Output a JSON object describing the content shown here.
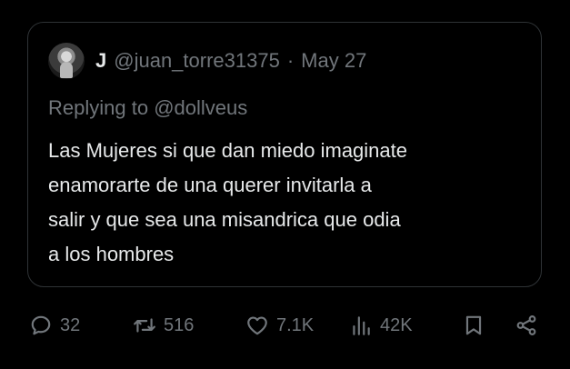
{
  "tweet": {
    "display_name": "J",
    "handle": "@juan_torre31375",
    "separator": "·",
    "date": "May 27",
    "replying_prefix": "Replying to",
    "replying_to": "@dollveus",
    "text_lines": [
      "Las Mujeres si que dan miedo imaginate",
      "enamorarte de una querer invitarla a",
      "salir y que sea una misandrica que odia",
      "a los hombres"
    ]
  },
  "actions": {
    "replies": "32",
    "retweets": "516",
    "likes": "7.1K",
    "views": "42K"
  },
  "icons": {
    "reply": "reply-bubble-icon",
    "retweet": "retweet-icon",
    "like": "heart-icon",
    "views": "views-bar-icon",
    "bookmark": "bookmark-icon",
    "share": "share-icon"
  },
  "colors": {
    "background": "#000000",
    "text": "#e7e9ea",
    "secondary": "#71767b",
    "border": "#2f3336"
  }
}
